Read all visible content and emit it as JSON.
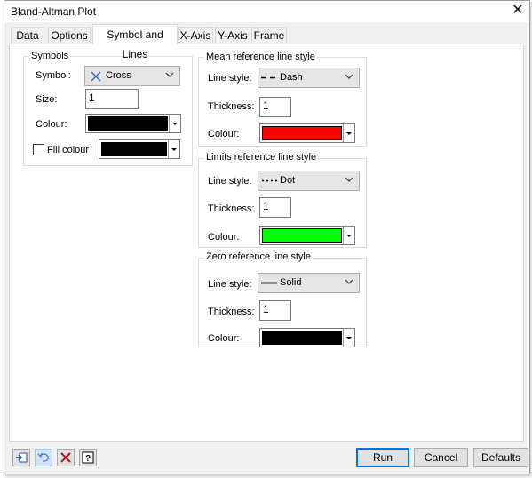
{
  "window": {
    "title": "Bland-Altman Plot"
  },
  "tabs": [
    {
      "label": "Data"
    },
    {
      "label": "Options"
    },
    {
      "label": "Symbol and Lines"
    },
    {
      "label": "X-Axis"
    },
    {
      "label": "Y-Axis"
    },
    {
      "label": "Frame"
    }
  ],
  "active_tab": "Symbol and Lines",
  "symbols": {
    "title": "Symbols",
    "symbol_label": "Symbol:",
    "symbol_value": "Cross",
    "size_label": "Size:",
    "size_value": "1",
    "colour_label": "Colour:",
    "colour": "#000000",
    "fill_label": "Fill colour",
    "fill_checked": false,
    "fill_colour": "#000000"
  },
  "mean_line": {
    "title": "Mean reference line style",
    "style_label": "Line style:",
    "style_value": "Dash",
    "thickness_label": "Thickness:",
    "thickness_value": "1",
    "colour_label": "Colour:",
    "colour": "#ff0000"
  },
  "limits_line": {
    "title": "Limits reference line style",
    "style_label": "Line style:",
    "style_value": "Dot",
    "thickness_label": "Thickness:",
    "thickness_value": "1",
    "colour_label": "Colour:",
    "colour": "#00ff00"
  },
  "zero_line": {
    "title": "Zero reference line style",
    "style_label": "Line style:",
    "style_value": "Solid",
    "thickness_label": "Thickness:",
    "thickness_value": "1",
    "colour_label": "Colour:",
    "colour": "#000000"
  },
  "footer": {
    "icons": [
      "restore-icon",
      "undo-icon",
      "clear-icon",
      "help-icon"
    ],
    "run_label": "Run",
    "cancel_label": "Cancel",
    "defaults_label": "Defaults"
  }
}
